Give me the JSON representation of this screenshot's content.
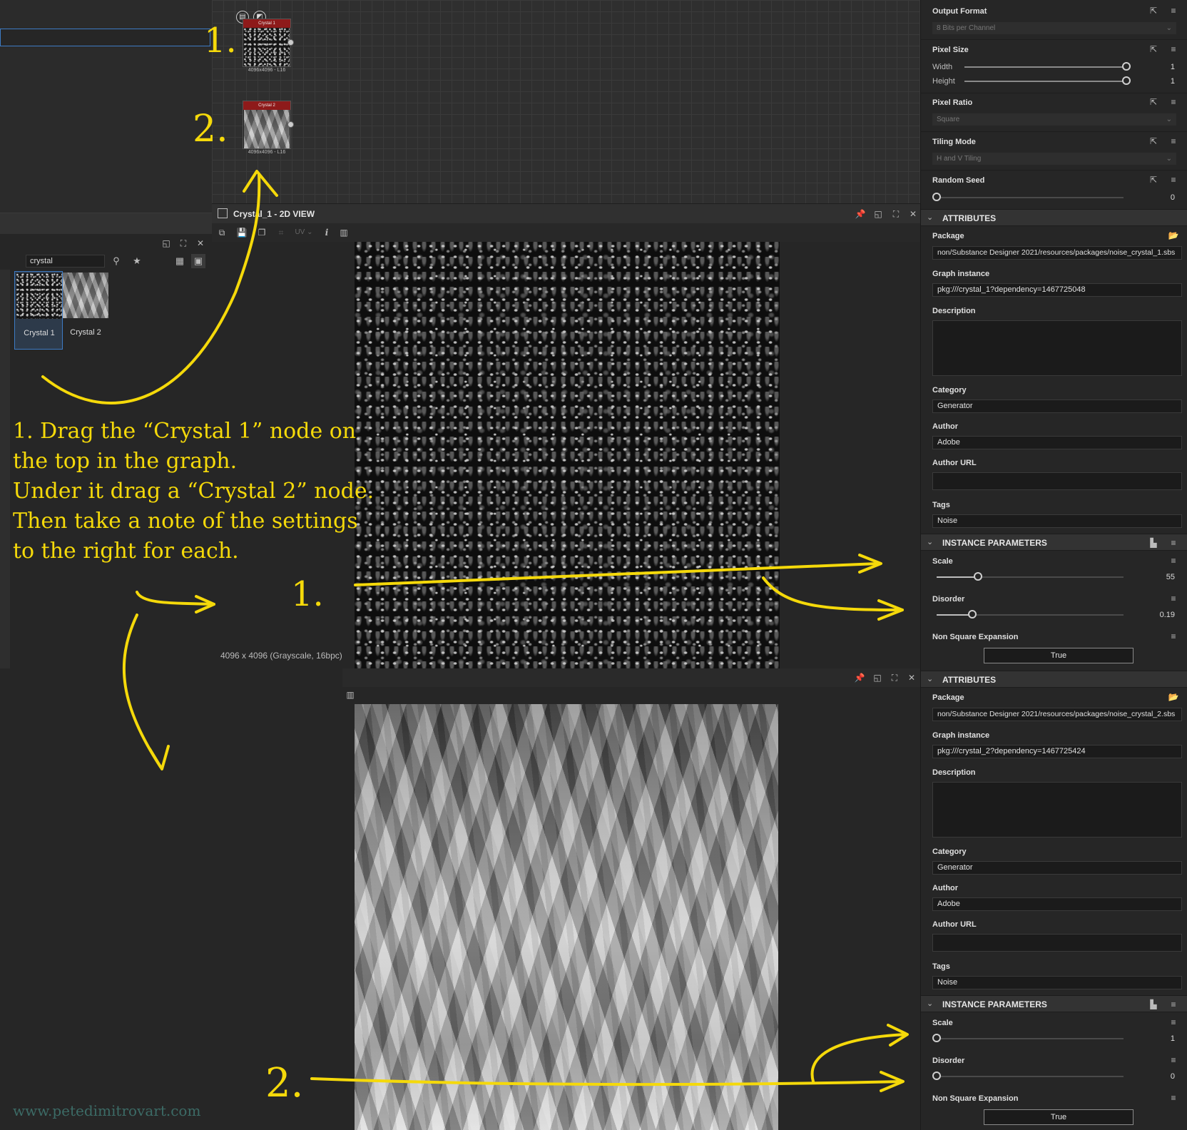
{
  "library": {
    "search_value": "crystal",
    "items": [
      {
        "label": "Crystal 1",
        "selected": true
      },
      {
        "label": "Crystal 2",
        "selected": false
      }
    ]
  },
  "graph": {
    "nodes": [
      {
        "title": "Crystal 1",
        "size_label": "4096x4096 - L16"
      },
      {
        "title": "Crystal 2",
        "size_label": "4096x4096 - L16"
      }
    ]
  },
  "view": {
    "title": "Crystal_1 - 2D VIEW",
    "uv_label": "UV",
    "status": "4096 x 4096 (Grayscale, 16bpc)"
  },
  "props": {
    "output_format": {
      "label": "Output Format",
      "value": "8 Bits per Channel"
    },
    "pixel_size": {
      "label": "Pixel Size",
      "width_label": "Width",
      "width_value": "1",
      "height_label": "Height",
      "height_value": "1"
    },
    "pixel_ratio": {
      "label": "Pixel Ratio",
      "value": "Square"
    },
    "tiling_mode": {
      "label": "Tiling Mode",
      "value": "H and V Tiling"
    },
    "random_seed": {
      "label": "Random Seed",
      "value": "0"
    },
    "attributes_1": {
      "title": "ATTRIBUTES",
      "package_label": "Package",
      "package_value": "non/Substance Designer 2021/resources/packages/noise_crystal_1.sbs",
      "graph_instance_label": "Graph instance",
      "graph_instance_value": "pkg:///crystal_1?dependency=1467725048",
      "description_label": "Description",
      "category_label": "Category",
      "category_value": "Generator",
      "author_label": "Author",
      "author_value": "Adobe",
      "author_url_label": "Author URL",
      "tags_label": "Tags",
      "tags_value": "Noise"
    },
    "instance_1": {
      "title": "INSTANCE PARAMETERS",
      "scale_label": "Scale",
      "scale_value": "55",
      "scale_frac": 0.22,
      "disorder_label": "Disorder",
      "disorder_value": "0.19",
      "disorder_frac": 0.19,
      "nse_label": "Non Square Expansion",
      "nse_value": "True"
    },
    "attributes_2": {
      "title": "ATTRIBUTES",
      "package_label": "Package",
      "package_value": "non/Substance Designer 2021/resources/packages/noise_crystal_2.sbs",
      "graph_instance_label": "Graph instance",
      "graph_instance_value": "pkg:///crystal_2?dependency=1467725424",
      "description_label": "Description",
      "category_label": "Category",
      "category_value": "Generator",
      "author_label": "Author",
      "author_value": "Adobe",
      "author_url_label": "Author URL",
      "tags_label": "Tags",
      "tags_value": "Noise"
    },
    "instance_2": {
      "title": "INSTANCE PARAMETERS",
      "scale_label": "Scale",
      "scale_value": "1",
      "scale_frac": 0.0,
      "disorder_label": "Disorder",
      "disorder_value": "0",
      "disorder_frac": 0.0,
      "nse_label": "Non Square Expansion",
      "nse_value": "True"
    }
  },
  "annotations": {
    "instructions": [
      "1. Drag the “Crystal 1” node on",
      "the top in the graph.",
      "Under it drag a “Crystal 2” node.",
      "Then take a note of the settings",
      "to the right for each."
    ],
    "marker_1": "1.",
    "marker_2": "2.",
    "watermark": "www.petedimitrovart.com"
  },
  "colors": {
    "annotation": "#f5d90a",
    "node_header": "#8e1a1a",
    "selection": "#3d7bc4"
  }
}
